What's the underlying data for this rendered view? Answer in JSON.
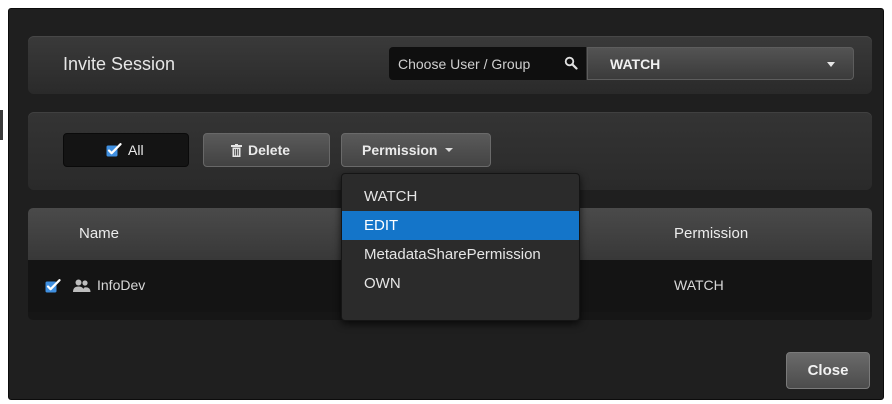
{
  "dialog": {
    "title": "Invite Session",
    "user_search": {
      "placeholder": "Choose User / Group",
      "icon": "search-icon"
    },
    "permission_select": {
      "value": "WATCH"
    }
  },
  "toolbar": {
    "all_label": "All",
    "delete_label": "Delete",
    "permission_label": "Permission"
  },
  "permission_menu": {
    "items": [
      "WATCH",
      "EDIT",
      "MetadataSharePermission",
      "OWN"
    ],
    "highlighted": "EDIT"
  },
  "table": {
    "columns": [
      "Name",
      "Permission"
    ],
    "rows": [
      {
        "name": "InfoDev",
        "type": "group",
        "checked": true,
        "permission": "WATCH"
      }
    ]
  },
  "footer": {
    "close_label": "Close"
  },
  "colors": {
    "accent": "#1475c9",
    "checkbox": "#3f8fe0"
  }
}
